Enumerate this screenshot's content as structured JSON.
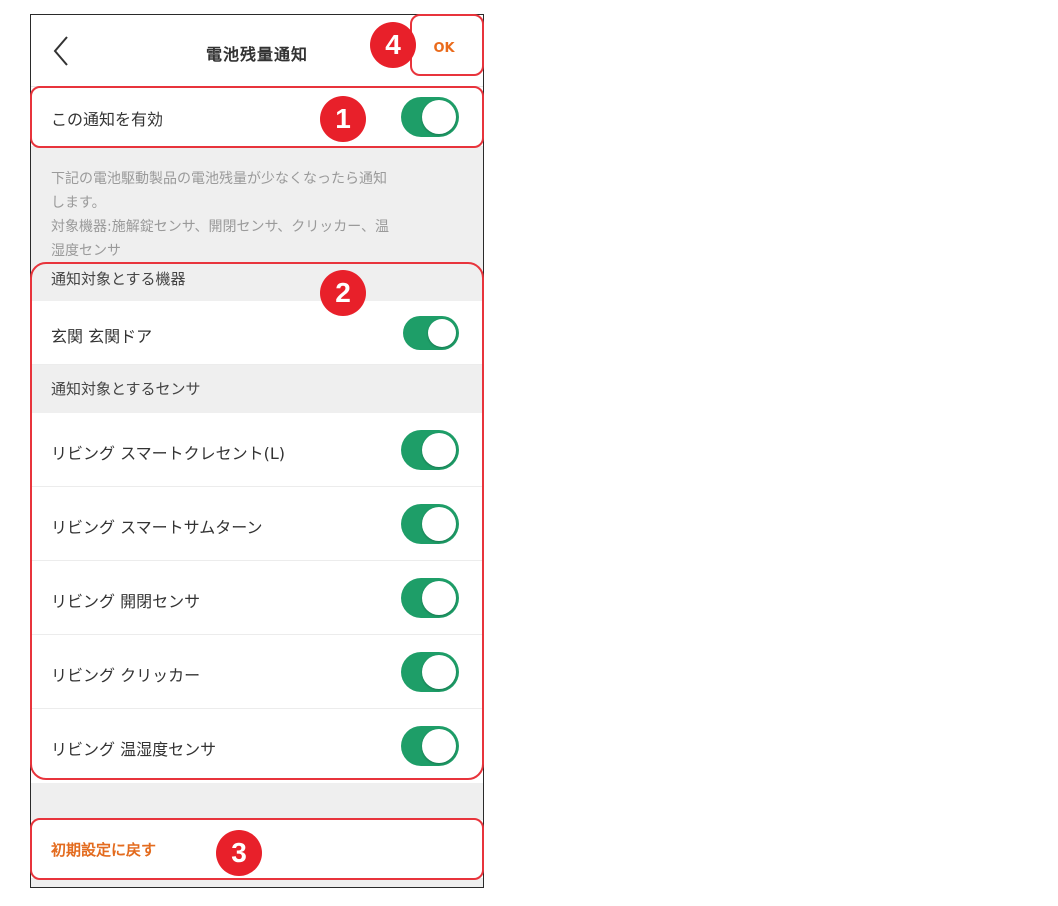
{
  "header": {
    "title": "電池残量通知",
    "ok_label": "OK"
  },
  "enable_row": {
    "label": "この通知を有効",
    "enabled": true
  },
  "description": {
    "line1": "下記の電池駆動製品の電池残量が少なくなったら通知",
    "line2": "します。",
    "line3": "対象機器:施解錠センサ、開閉センサ、クリッカー、温",
    "line4": "湿度センサ"
  },
  "devices_section": {
    "header": "通知対象とする機器",
    "items": [
      {
        "label": "玄関 玄関ドア",
        "enabled": true
      }
    ]
  },
  "sensors_section": {
    "header": "通知対象とするセンサ",
    "items": [
      {
        "label": "リビング スマートクレセント(L)",
        "enabled": true
      },
      {
        "label": "リビング スマートサムターン",
        "enabled": true
      },
      {
        "label": "リビング 開閉センサ",
        "enabled": true
      },
      {
        "label": "リビング クリッカー",
        "enabled": true
      },
      {
        "label": "リビング 温湿度センサ",
        "enabled": true
      }
    ]
  },
  "reset": {
    "label": "初期設定に戻す"
  },
  "callouts": {
    "one": "1",
    "two": "2",
    "three": "3",
    "four": "4"
  },
  "colors": {
    "accent_orange": "#ea6b1c",
    "toggle_green": "#1e9e68",
    "callout_red": "#e8202a"
  }
}
